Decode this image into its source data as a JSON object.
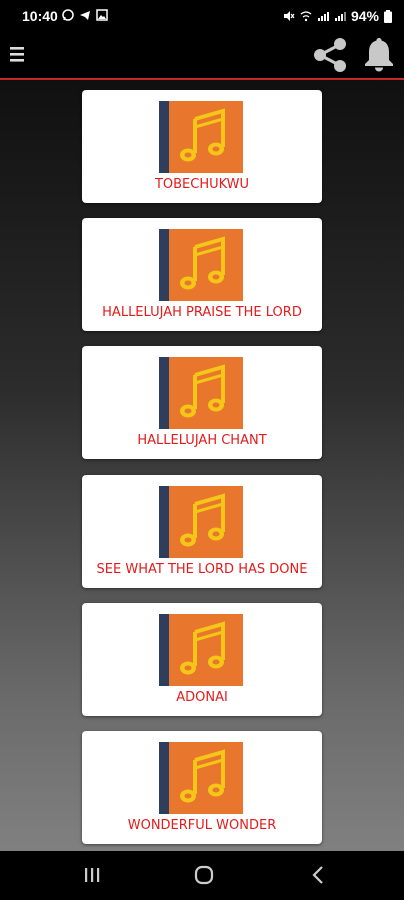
{
  "status_bar": {
    "time": "10:40",
    "battery": "94%"
  },
  "app_bar": {
    "menu_icon": "hamburger-menu-icon",
    "share_icon": "share-icon",
    "bell_icon": "bell-icon",
    "accent_color": "#c62828"
  },
  "songs": [
    {
      "title": "TOBECHUKWU"
    },
    {
      "title": "HALLELUJAH PRAISE THE LORD"
    },
    {
      "title": "HALLELUJAH CHANT"
    },
    {
      "title": "SEE WHAT THE LORD HAS DONE"
    },
    {
      "title": "ADONAI"
    },
    {
      "title": "WONDERFUL WONDER"
    }
  ],
  "song_icon": "music-note-book-icon",
  "colors": {
    "label": "#e21b1b",
    "book_orange": "#e8762c",
    "book_spine": "#2e3e5c",
    "note_yellow": "#f5c518"
  },
  "nav_bar": {
    "recents_icon": "recents-icon",
    "home_icon": "home-icon",
    "back_icon": "back-icon"
  }
}
